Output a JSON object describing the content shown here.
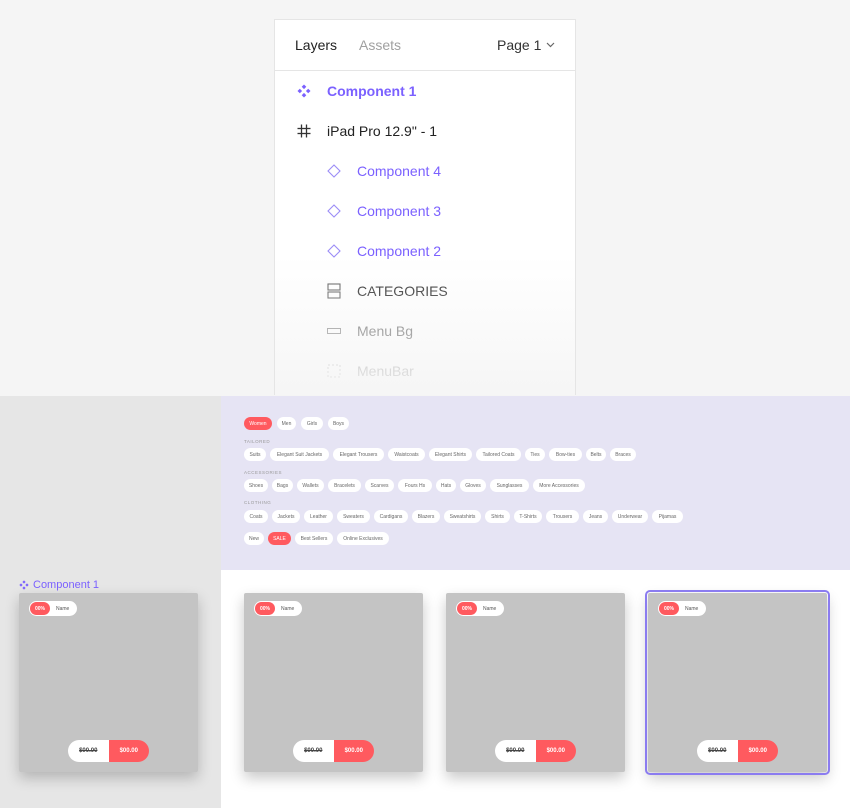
{
  "panel": {
    "tabs": [
      "Layers",
      "Assets"
    ],
    "page_select": "Page 1",
    "layers": [
      {
        "label": "Component 1",
        "icon": "component-main-icon"
      },
      {
        "label": "iPad Pro 12.9\" - 1",
        "icon": "frame-icon"
      },
      {
        "label": "Component 4",
        "icon": "instance-icon"
      },
      {
        "label": "Component 3",
        "icon": "instance-icon"
      },
      {
        "label": "Component 2",
        "icon": "instance-icon"
      },
      {
        "label": "CATEGORIES",
        "icon": "group-icon"
      },
      {
        "label": "Menu Bg",
        "icon": "rectangle-icon"
      },
      {
        "label": "MenuBar",
        "icon": "frame-dashed-icon"
      }
    ]
  },
  "canvas": {
    "component_label": "Component 1",
    "menu": {
      "top": [
        "Women",
        "Men",
        "Girls",
        "Boys"
      ],
      "sections": {
        "tailored": "TAILORED",
        "accessories": "ACCESSORIES",
        "clothing": "CLOTHING"
      },
      "tailored": [
        "Suits",
        "Elegant Suit Jackets",
        "Elegant Trousers",
        "Waistcoats",
        "Elegant Shirts",
        "Tailored Coats",
        "Ties",
        "Bow-ties",
        "Belts",
        "Braces"
      ],
      "accessories": [
        "Shoes",
        "Bags",
        "Wallets",
        "Bracelets",
        "Scarves",
        "Fours Hs",
        "Hats",
        "Gloves",
        "Sunglasses",
        "More Accessories"
      ],
      "clothing": [
        "Coats",
        "Jackets",
        "Leather",
        "Sweaters",
        "Cardigans",
        "Blazers",
        "Sweatshirts",
        "Shirts",
        "T-Shirts",
        "Trousers",
        "Jeans",
        "Underwear",
        "Pijamas"
      ],
      "bottom": [
        "New",
        "SALE",
        "Best Sellers",
        "Online Exclusives"
      ]
    },
    "card": {
      "discount": "00%",
      "name": "Name",
      "old_price": "$00.00",
      "new_price": "$00.00"
    }
  },
  "colors": {
    "accent": "#7b61ff",
    "sale": "#ff5a5f",
    "menu_bg": "#e6e4f4",
    "card_bg": "#c4c4c4"
  }
}
